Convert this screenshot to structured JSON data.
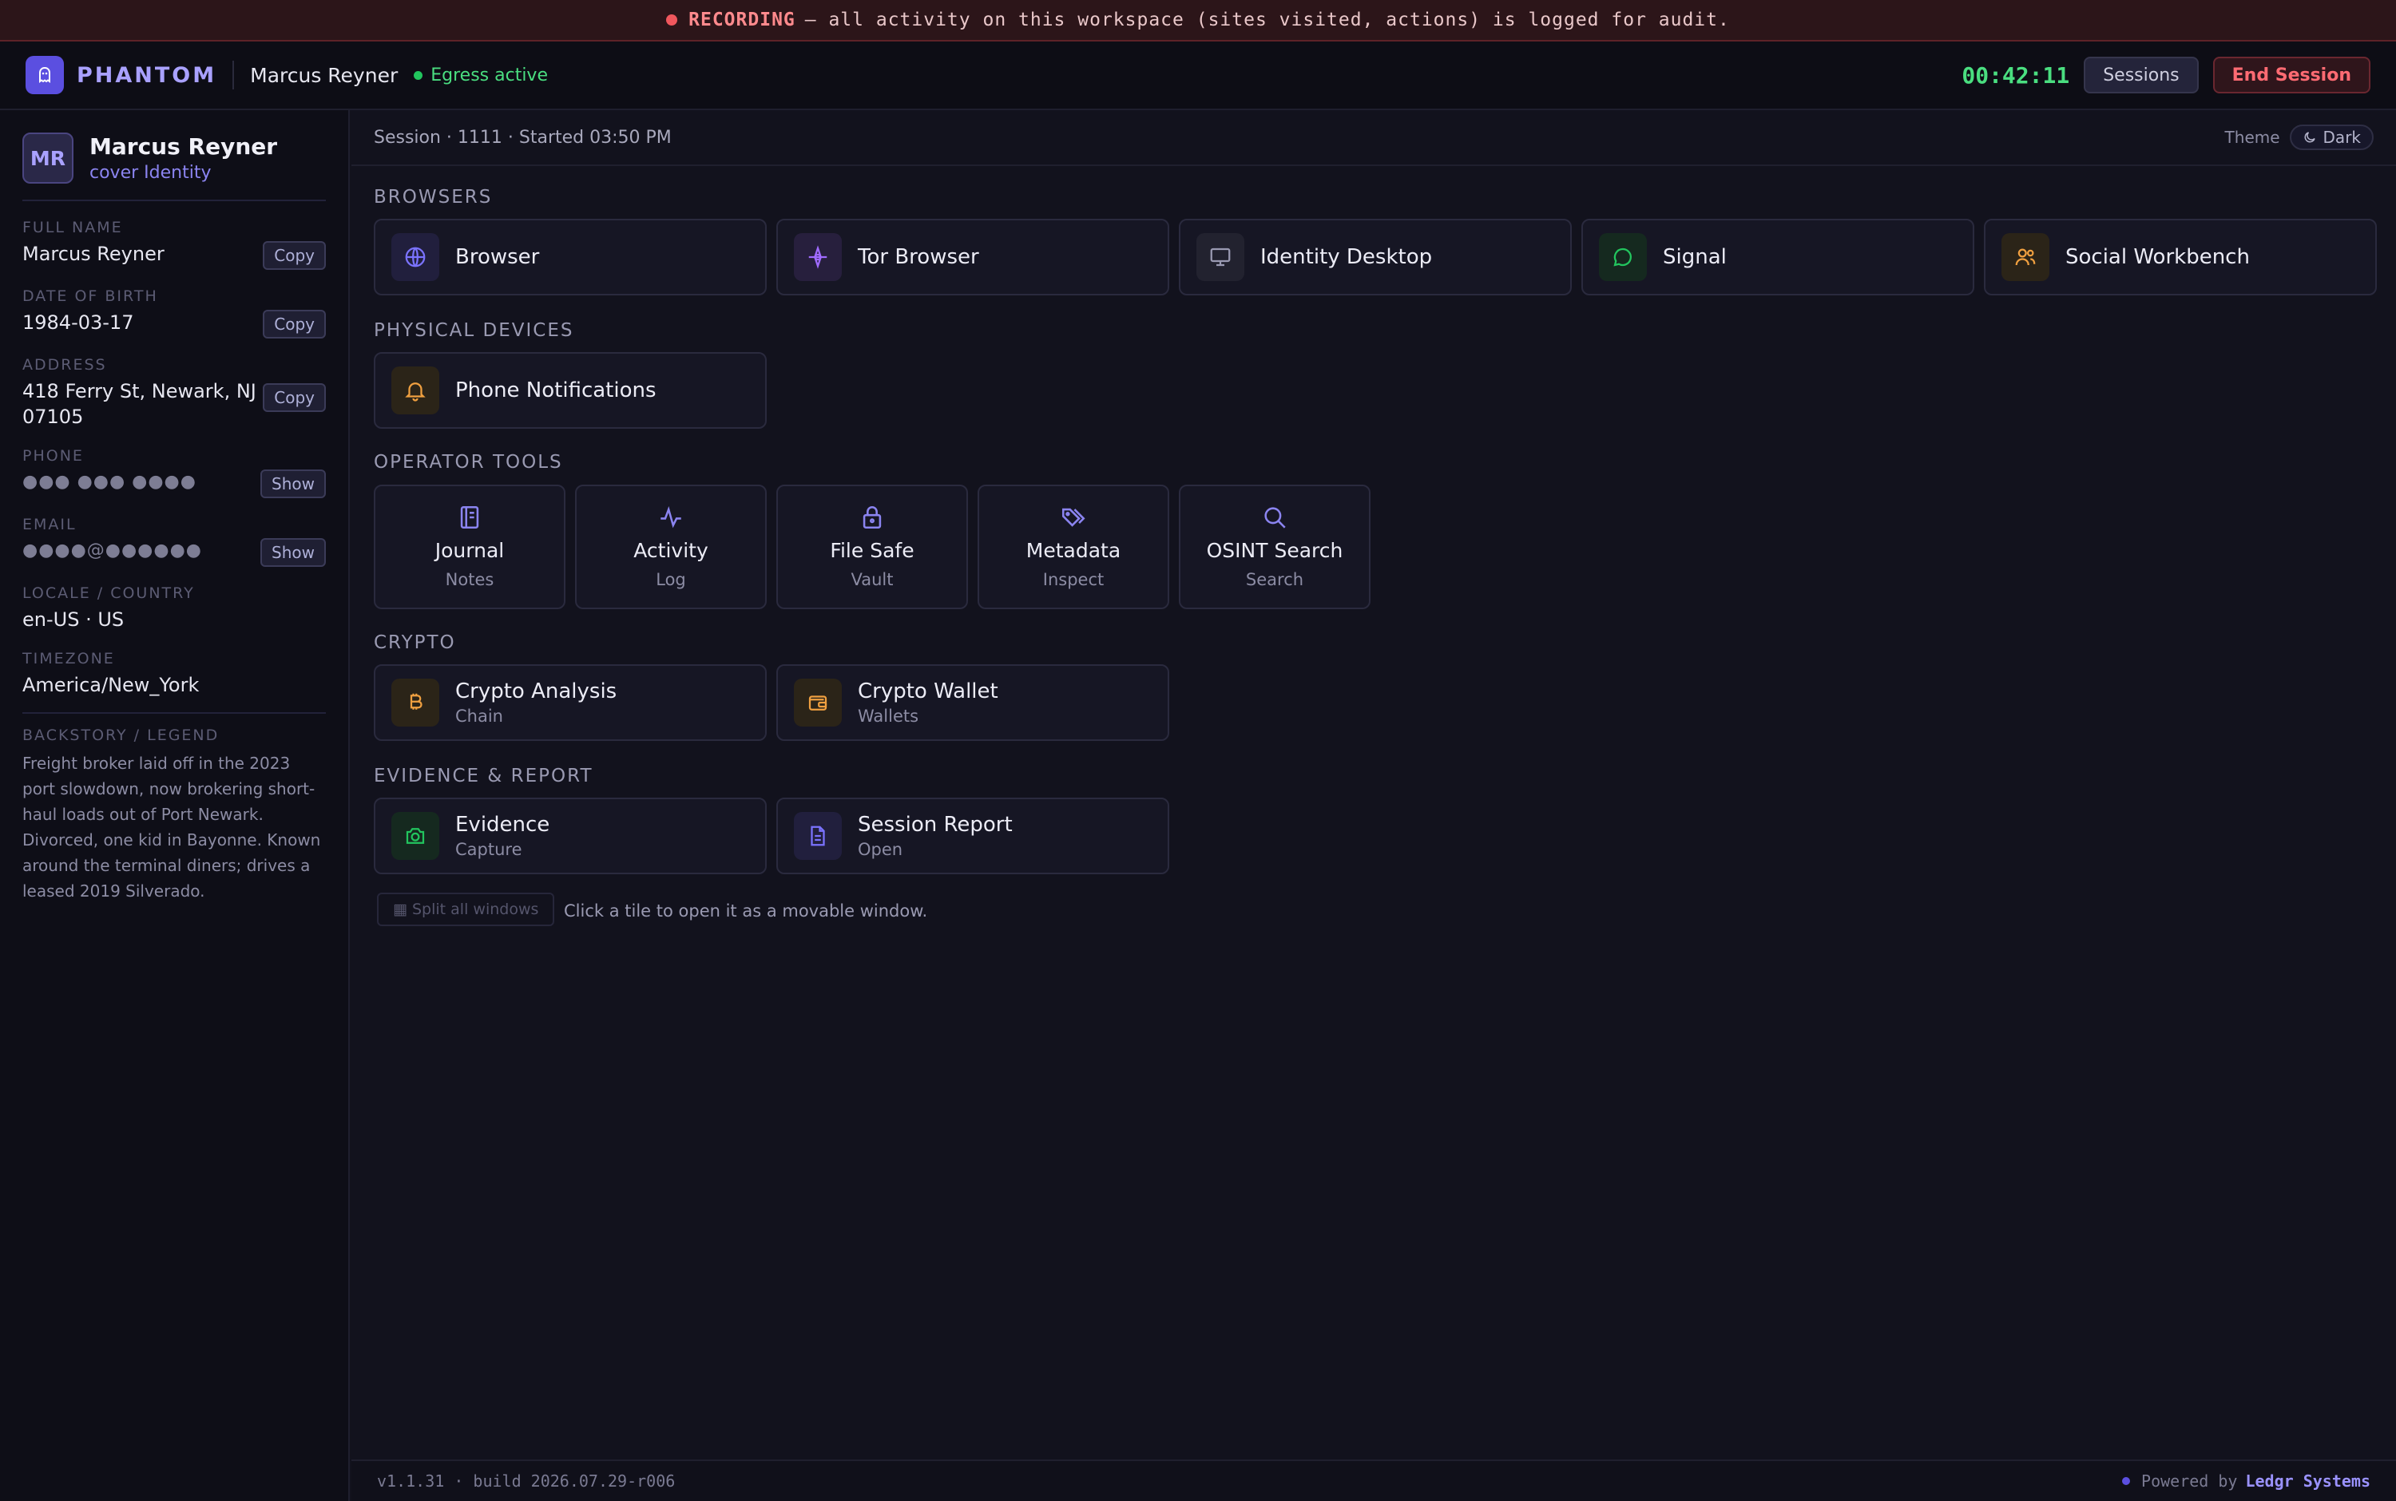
{
  "banner": {
    "label": "RECORDING",
    "text": "— all activity on this workspace (sites visited, actions) is logged for audit."
  },
  "topbar": {
    "brand": "PHANTOM",
    "user": "Marcus Reyner",
    "egress": "Egress active",
    "timer": "00:42:11",
    "sessions_label": "Sessions",
    "end_label": "End Session"
  },
  "sidebar": {
    "initials": "MR",
    "name": "Marcus Reyner",
    "role": "cover Identity",
    "fields": [
      {
        "label": "FULL NAME",
        "value": "Marcus Reyner",
        "action": "Copy"
      },
      {
        "label": "DATE OF BIRTH",
        "value": "1984-03-17",
        "action": "Copy"
      },
      {
        "label": "ADDRESS",
        "value": "418 Ferry St, Newark, NJ 07105",
        "action": "Copy"
      },
      {
        "label": "PHONE",
        "value": "●●● ●●● ●●●●",
        "action": "Show"
      },
      {
        "label": "EMAIL",
        "value": "●●●●@●●●●●●",
        "action": "Show"
      },
      {
        "label": "LOCALE / COUNTRY",
        "value": "en-US · US"
      },
      {
        "label": "TIMEZONE",
        "value": "America/New_York"
      }
    ],
    "backstory_label": "BACKSTORY / LEGEND",
    "backstory": "Freight broker laid off in the 2023 port slowdown, now brokering short-haul loads out of Port Newark. Divorced, one kid in Bayonne. Known around the terminal diners; drives a leased 2019 Silverado."
  },
  "main": {
    "session_info": "Session · 1111 · Started 03:50 PM",
    "theme_label": "Theme",
    "theme_value": "Dark",
    "sections": {
      "browsers": "BROWSERS",
      "devices": "PHYSICAL DEVICES",
      "tools": "OPERATOR TOOLS",
      "crypto": "CRYPTO",
      "evidence": "EVIDENCE & REPORT"
    },
    "browsers": [
      {
        "label": "Browser",
        "icon": "globe-icon",
        "color": "#7b73ff"
      },
      {
        "label": "Tor Browser",
        "icon": "tor-icon",
        "color": "#a06bff"
      },
      {
        "label": "Identity Desktop",
        "icon": "monitor-icon",
        "color": "#9a9ab2"
      },
      {
        "label": "Signal",
        "icon": "chat-icon",
        "color": "#22c55e"
      },
      {
        "label": "Social Workbench",
        "icon": "users-icon",
        "color": "#f0a040"
      }
    ],
    "devices": [
      {
        "label": "Phone Notifications",
        "icon": "bell-icon",
        "color": "#f0a040"
      }
    ],
    "tools": [
      {
        "label": "Journal",
        "sub": "Notes",
        "icon": "journal-icon"
      },
      {
        "label": "Activity",
        "sub": "Log",
        "icon": "pulse-icon"
      },
      {
        "label": "File Safe",
        "sub": "Vault",
        "icon": "lock-icon"
      },
      {
        "label": "Metadata",
        "sub": "Inspect",
        "icon": "tags-icon"
      },
      {
        "label": "OSINT Search",
        "sub": "Search",
        "icon": "search-icon"
      }
    ],
    "crypto": [
      {
        "label": "Crypto Analysis",
        "sub": "Chain",
        "icon": "bitcoin-icon",
        "color": "#f0a040"
      },
      {
        "label": "Crypto Wallet",
        "sub": "Wallets",
        "icon": "wallet-icon",
        "color": "#f0a040"
      }
    ],
    "evidence": [
      {
        "label": "Evidence",
        "sub": "Capture",
        "icon": "camera-icon",
        "color": "#22c55e"
      },
      {
        "label": "Session Report",
        "sub": "Open",
        "icon": "document-icon",
        "color": "#7b73ff"
      }
    ],
    "split_label": "▦ Split all windows",
    "hint": "Click a tile to open it as a movable window."
  },
  "footer": {
    "build": "v1.1.31 · build 2026.07.29-r006",
    "powered": "Powered by",
    "company": "Ledgr Systems"
  }
}
